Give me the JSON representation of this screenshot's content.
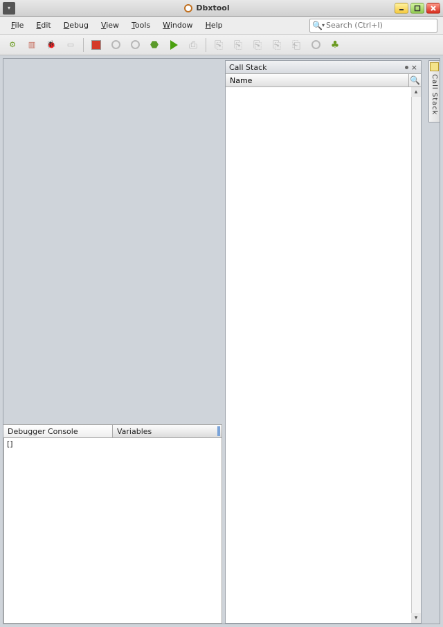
{
  "titlebar": {
    "title": "Dbxtool"
  },
  "menus": [
    {
      "label": "File",
      "accel": "F"
    },
    {
      "label": "Edit",
      "accel": "E"
    },
    {
      "label": "Debug",
      "accel": "D"
    },
    {
      "label": "View",
      "accel": "V"
    },
    {
      "label": "Tools",
      "accel": "T"
    },
    {
      "label": "Window",
      "accel": "W"
    },
    {
      "label": "Help",
      "accel": "H"
    }
  ],
  "search": {
    "placeholder": "Search (Ctrl+I)"
  },
  "toolbar": {
    "buttons": [
      {
        "name": "new-project",
        "icon": "gear"
      },
      {
        "name": "attach",
        "icon": "calendar"
      },
      {
        "name": "debug",
        "icon": "bug"
      },
      {
        "name": "new-watch",
        "icon": "dim-box"
      },
      {
        "name": "__sep"
      },
      {
        "name": "stop",
        "icon": "stop"
      },
      {
        "name": "pause",
        "icon": "circ-dim"
      },
      {
        "name": "step",
        "icon": "circ-dim"
      },
      {
        "name": "pin",
        "icon": "pin"
      },
      {
        "name": "continue",
        "icon": "play"
      },
      {
        "name": "step-over1",
        "icon": "tray"
      },
      {
        "name": "__sep"
      },
      {
        "name": "step-over2",
        "icon": "tray"
      },
      {
        "name": "step-into",
        "icon": "tray"
      },
      {
        "name": "step-out",
        "icon": "tray"
      },
      {
        "name": "run-to",
        "icon": "tray"
      },
      {
        "name": "return",
        "icon": "tray"
      },
      {
        "name": "slot",
        "icon": "circ-dim"
      },
      {
        "name": "profile",
        "icon": "net"
      }
    ]
  },
  "tabs": {
    "console": "Debugger Console",
    "variables": "Variables"
  },
  "console": {
    "prompt": "[]"
  },
  "panel": {
    "title": "Call Stack",
    "columns": [
      "Name"
    ],
    "rows": []
  },
  "dock": {
    "label": "Call Stack"
  },
  "colors": {
    "accent_green": "#5a9a2a",
    "stop_red": "#d43a2a",
    "panel_bg": "#cfd4da"
  }
}
